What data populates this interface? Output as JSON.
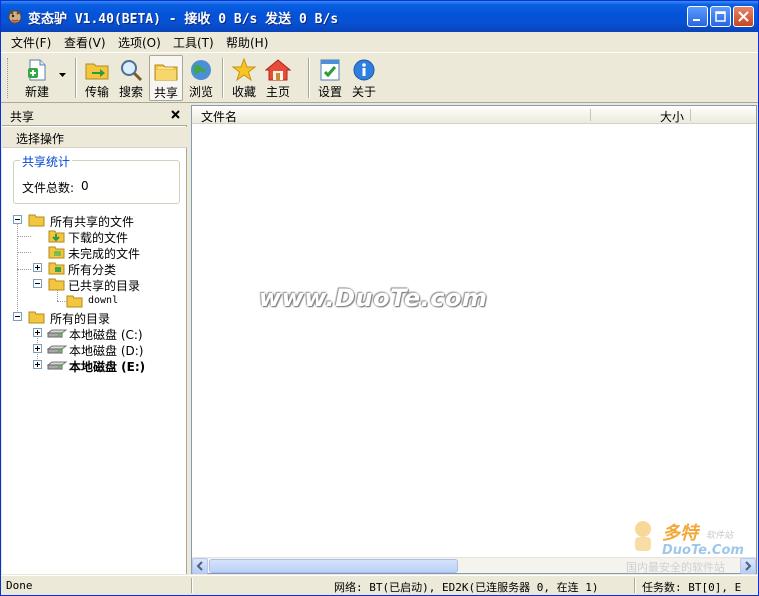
{
  "window": {
    "title": "变态驴 V1.40(BETA) - 接收 0 B/s 发送 0 B/s"
  },
  "menu": [
    "文件(F)",
    "查看(V)",
    "选项(O)",
    "工具(T)",
    "帮助(H)"
  ],
  "toolbar": {
    "new": "新建",
    "transfer": "传输",
    "search": "搜索",
    "share": "共享",
    "browse": "浏览",
    "favorites": "收藏",
    "home": "主页",
    "settings": "设置",
    "about": "关于"
  },
  "left_pane": {
    "title": "共享",
    "op_header": "选择操作",
    "stats": {
      "legend": "共享统计",
      "label": "文件总数:",
      "value": "0"
    }
  },
  "tree": {
    "all_shared": "所有共享的文件",
    "downloaded": "下载的文件",
    "incomplete": "未完成的文件",
    "categories": "所有分类",
    "shared_dirs": "已共享的目录",
    "downl": "downl",
    "all_dirs": "所有的目录",
    "disk_c": "本地磁盘 (C:)",
    "disk_d": "本地磁盘 (D:)",
    "disk_e": "本地磁盘 (E:)"
  },
  "list": {
    "columns": [
      "文件名",
      "大小"
    ]
  },
  "watermark": {
    "main": "www.DuoTe.com",
    "logo_cn": "多特",
    "logo_sub": "软件站",
    "logo_en": "DuoTe.Com",
    "logo_slogan": "国内最安全的软件站"
  },
  "status": {
    "left": "Done",
    "network": "网络: BT(已启动), ED2K(已连服务器 0, 在连 1)",
    "tasks": "任务数: BT[0], E"
  },
  "colors": {
    "title_blue": "#0453d9",
    "window_bg": "#ece9d8",
    "legend_blue": "#0046d5"
  }
}
